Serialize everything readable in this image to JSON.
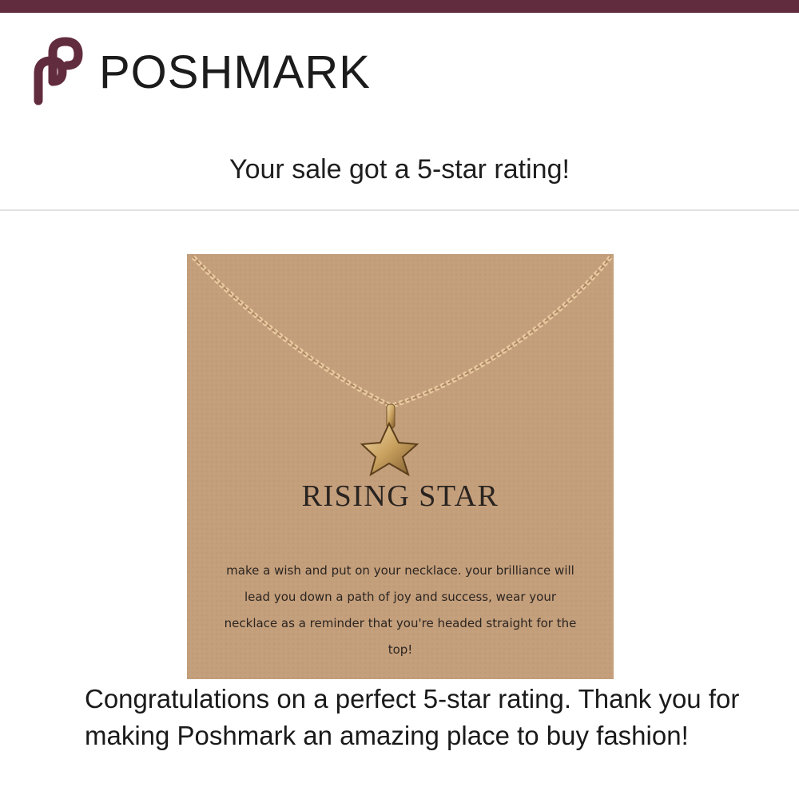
{
  "brand": {
    "name": "POSHMARK",
    "logo_icon": "poshmark-logo-icon",
    "color": "#622c3f"
  },
  "email": {
    "subject": "Your sale got a 5-star rating!",
    "message": "Congratulations on a perfect 5-star rating. Thank you for making Poshmark an amazing place to buy fashion!"
  },
  "product": {
    "image_icon": "star-necklace-image",
    "card_title": "RISING STAR",
    "card_text": "make a wish and put on your necklace. your brilliance will lead you down a path of joy and success, wear your necklace as a reminder that you're headed straight for the top!",
    "card_color": "#c49f7c"
  }
}
